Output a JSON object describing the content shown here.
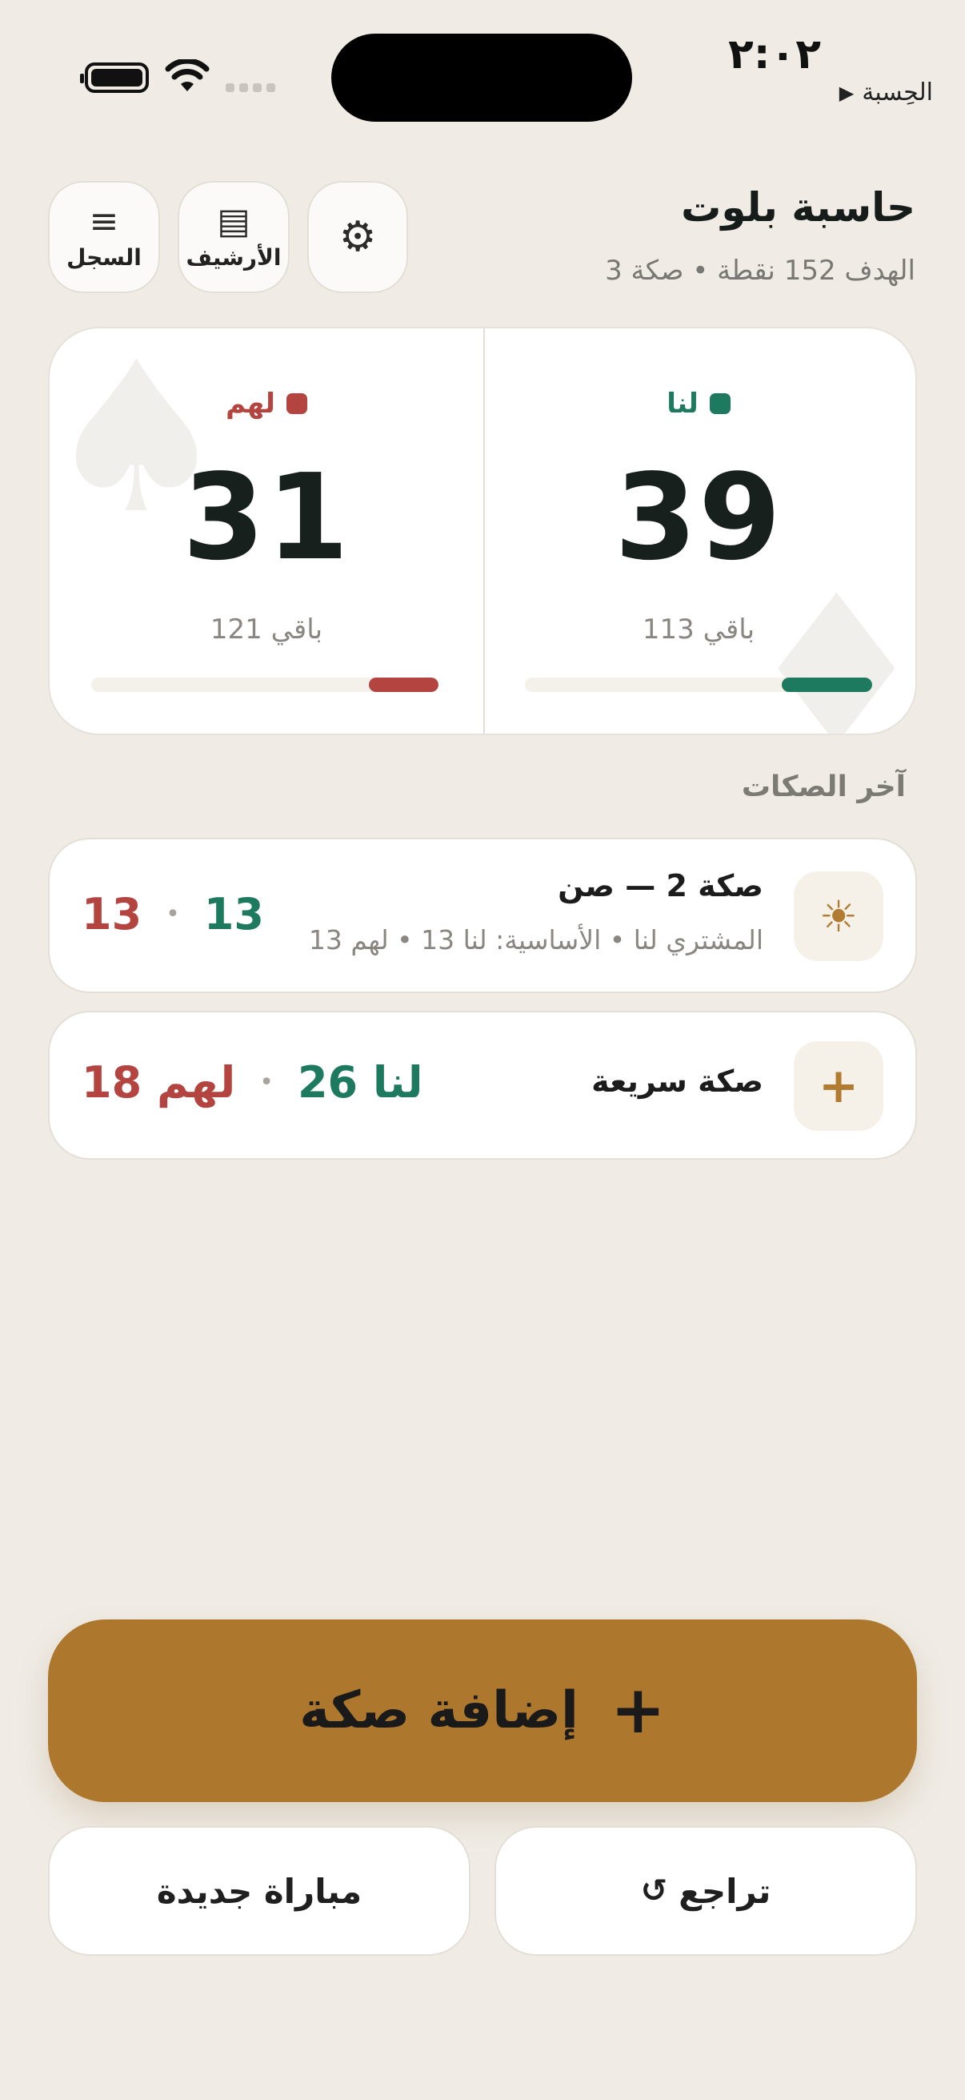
{
  "status_bar": {
    "time": "٢:٠٢",
    "back_label": "الحِسبة",
    "back_arrow": "▶"
  },
  "header": {
    "title": "حاسبة بلوت",
    "subtitle": "الهدف 152 نقطة • صكة 3",
    "buttons": [
      {
        "label": "السجل",
        "icon": "menu-icon",
        "glyph": "≡"
      },
      {
        "label": "الأرشيف",
        "icon": "archive-icon",
        "glyph": "▤"
      },
      {
        "label": "",
        "icon": "gear-icon",
        "glyph": "⚙"
      }
    ]
  },
  "scoreboard": {
    "us": {
      "name": "لنا",
      "score": "39",
      "remaining": "باقي 113",
      "progress": 0.26,
      "color": "#1E7A5E"
    },
    "them": {
      "name": "لهم",
      "score": "31",
      "remaining": "باقي 121",
      "progress": 0.2,
      "color": "#B4443F"
    }
  },
  "recent": {
    "heading": "آخر الصكات",
    "rounds": [
      {
        "icon": "sun-icon",
        "glyph": "☀",
        "title": "صكة 2 — صن",
        "detail": "المشتري لنا • الأساسية: لنا 13 • لهم 13",
        "us_points": "13",
        "them_points": "13",
        "separator": "•"
      },
      {
        "icon": "plus-icon",
        "glyph": "+",
        "title": "صكة سريعة",
        "us_points": "لنا 26",
        "them_points": "لهم 18",
        "separator": "•"
      }
    ]
  },
  "actions": {
    "add_round": "إضافة صكة",
    "add_glyph": "+",
    "undo": "تراجع",
    "undo_glyph": "↺",
    "new_match": "مباراة جديدة"
  },
  "colors": {
    "background": "#F0ECE5",
    "accent_gold": "#AD782D",
    "us_green": "#1E7A5E",
    "them_red": "#B4443F"
  }
}
